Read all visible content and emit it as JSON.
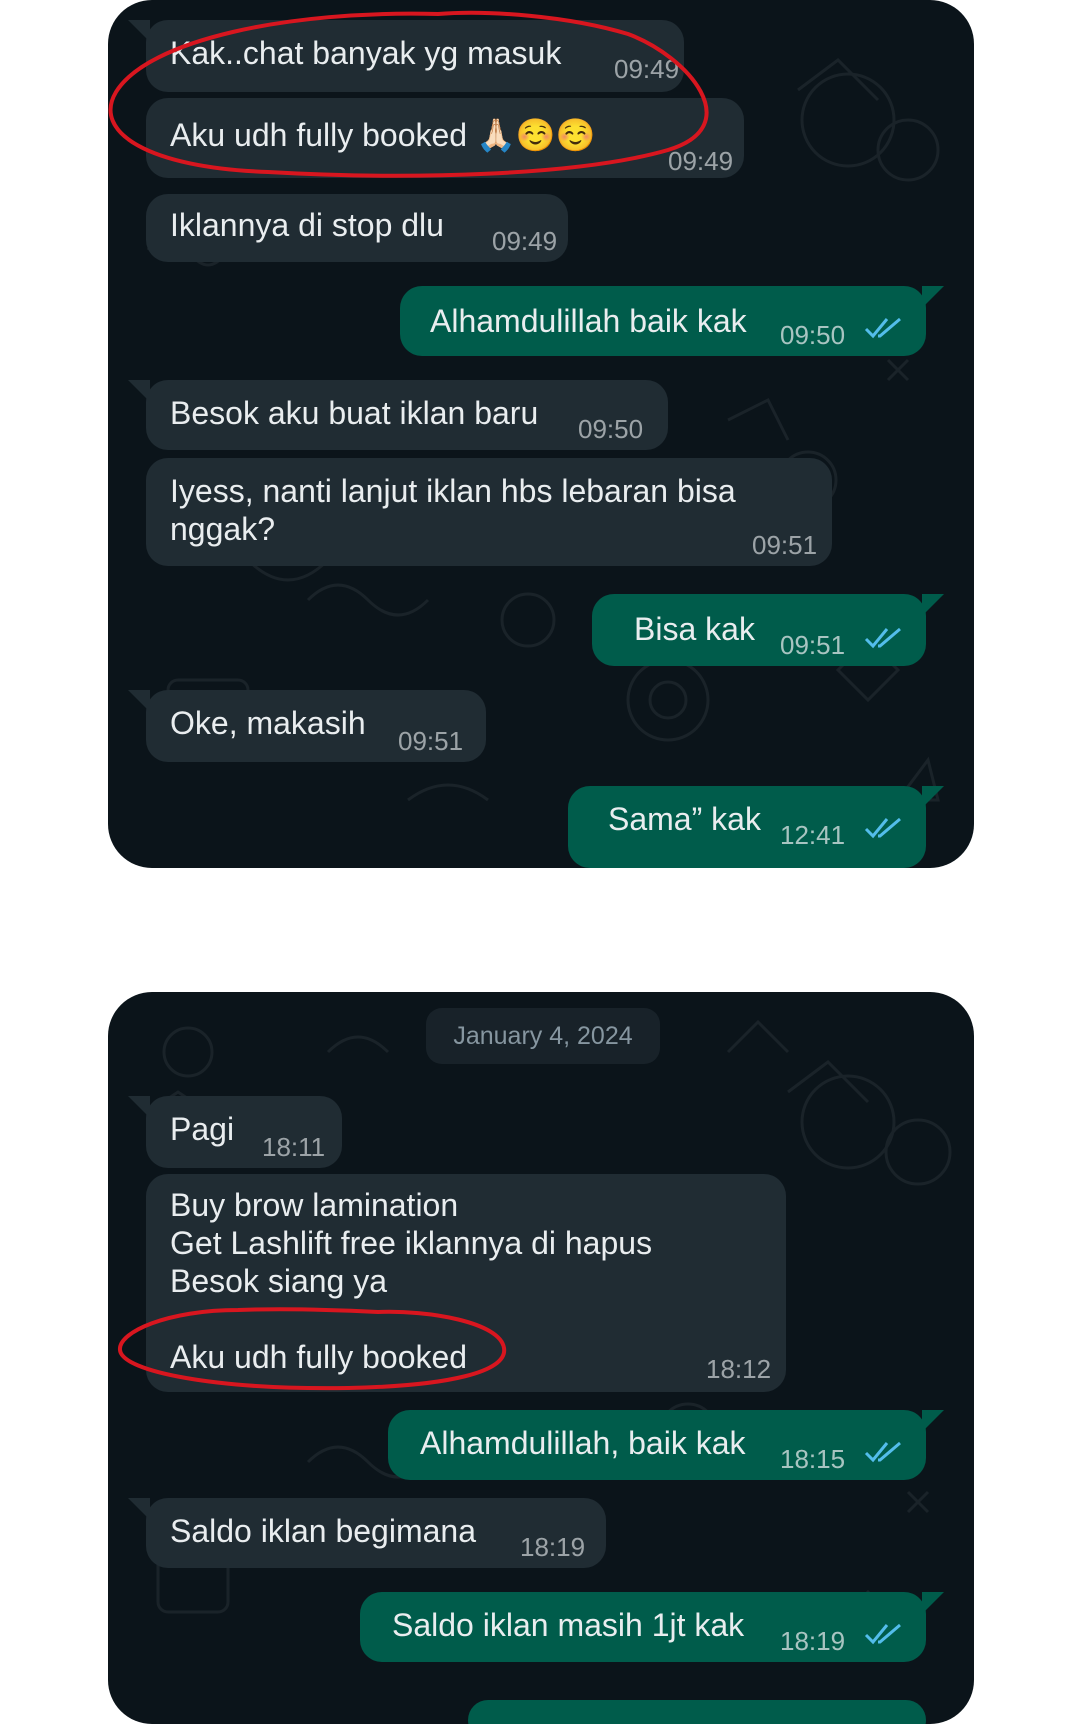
{
  "accent_colors": {
    "incoming_bubble": "#202c33",
    "outgoing_bubble": "#005c4b",
    "read_ticks": "#53bdeb",
    "chat_background": "#0b141a",
    "annotation": "#d8161f"
  },
  "panel1": {
    "messages": [
      {
        "dir": "in",
        "text": "Kak..chat banyak yg masuk",
        "time": "09:49"
      },
      {
        "dir": "in",
        "text": "Aku udh fully booked 🙏🏻☺️☺️",
        "time": "09:49"
      },
      {
        "dir": "in",
        "text": "Iklannya di stop dlu",
        "time": "09:49"
      },
      {
        "dir": "out",
        "text": "Alhamdulillah baik kak",
        "time": "09:50",
        "status_icon": "double-check-read-icon"
      },
      {
        "dir": "in",
        "text": "Besok aku buat iklan baru",
        "time": "09:50"
      },
      {
        "dir": "in",
        "text": "Iyess, nanti lanjut iklan hbs lebaran bisa\nnggak?",
        "time": "09:51"
      },
      {
        "dir": "out",
        "text": "Bisa kak",
        "time": "09:51",
        "status_icon": "double-check-read-icon"
      },
      {
        "dir": "in",
        "text": "Oke, makasih",
        "time": "09:51"
      },
      {
        "dir": "out",
        "text": "Sama” kak",
        "time": "12:41",
        "status_icon": "double-check-read-icon"
      }
    ]
  },
  "panel2": {
    "date_chip": "January 4, 2024",
    "messages": [
      {
        "dir": "in",
        "text": "Pagi",
        "time": "18:11"
      },
      {
        "dir": "in",
        "text": "Buy brow lamination\nGet Lashlift free iklannya di hapus\nBesok siang ya\n\nAku udh fully booked",
        "time": "18:12"
      },
      {
        "dir": "out",
        "text": "Alhamdulillah, baik kak",
        "time": "18:15",
        "status_icon": "double-check-read-icon"
      },
      {
        "dir": "in",
        "text": "Saldo iklan begimana",
        "time": "18:19"
      },
      {
        "dir": "out",
        "text": "Saldo iklan masih 1jt kak",
        "time": "18:19",
        "status_icon": "double-check-read-icon"
      }
    ]
  }
}
